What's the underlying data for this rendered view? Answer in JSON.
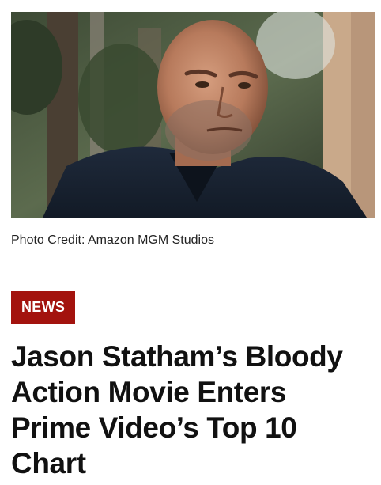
{
  "article": {
    "hero_image_alt": "Man with shaved head and grey stubble in a dark navy jacket standing among pine trees",
    "photo_credit": "Photo Credit: Amazon MGM Studios",
    "category_tag": "NEWS",
    "headline": "Jason Statham’s Bloody Action Movie Enters Prime Video’s Top 10 Chart"
  },
  "colors": {
    "tag_background": "#a3130e",
    "tag_text": "#ffffff",
    "headline_text": "#111111",
    "credit_text": "#222222"
  }
}
